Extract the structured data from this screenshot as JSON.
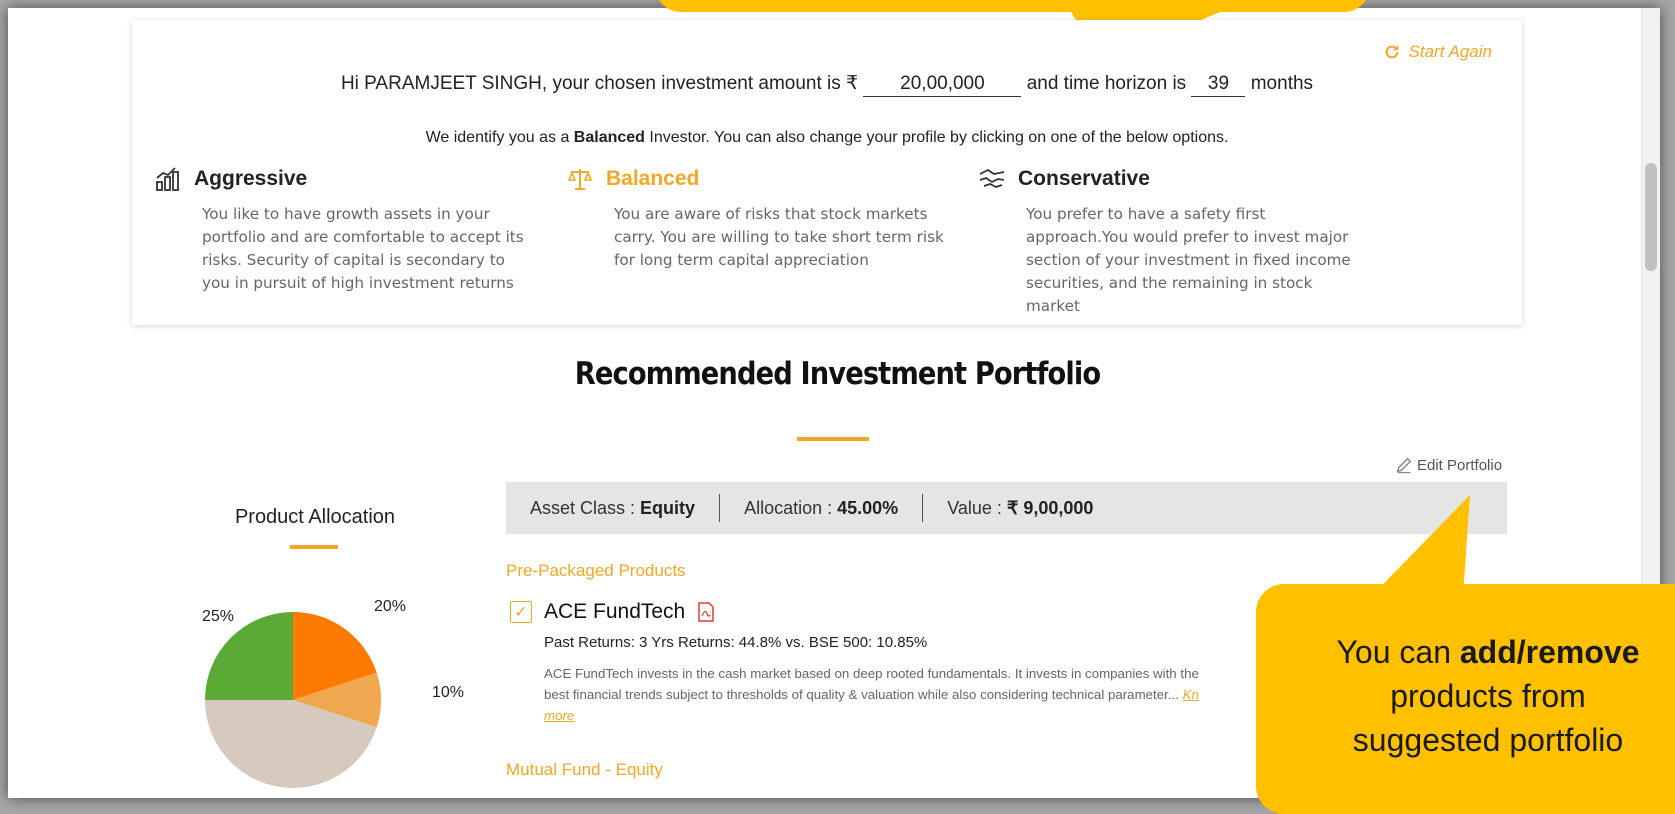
{
  "header": {
    "start_again": "Start Again",
    "greeting_prefix": "Hi PARAMJEET SINGH, your chosen investment amount is",
    "currency": "₹",
    "amount": "20,00,000",
    "horizon_prefix": "and time horizon is",
    "months": "39",
    "months_suffix": "months",
    "identify_prefix": "We identify you as a",
    "identify_profile": "Balanced",
    "identify_suffix": "Investor. You can also change your profile by clicking on one of the below options."
  },
  "profiles": [
    {
      "title": "Aggressive",
      "icon": "chart-growth-icon",
      "desc": "You like to have growth assets in your portfolio and are comfortable to accept its risks. Security of capital is secondary to you in pursuit of high investment returns"
    },
    {
      "title": "Balanced",
      "icon": "scale-icon",
      "desc": "You are aware of risks that stock markets carry. You are willing to take short term risk for long term capital appreciation"
    },
    {
      "title": "Conservative",
      "icon": "handshake-icon",
      "desc": "You prefer to have a safety first approach.You would prefer to invest major section of your investment in fixed income securities, and the remaining in stock market"
    }
  ],
  "portfolio": {
    "title": "Recommended Investment Portfolio",
    "edit_label": "Edit Portfolio",
    "allocation_heading": "Product Allocation",
    "pie_labels": [
      "25%",
      "20%",
      "10%"
    ],
    "pie_slices": [
      {
        "value": 20,
        "color": "#ff7a00"
      },
      {
        "value": 10,
        "color": "#f0a850"
      },
      {
        "value": 45,
        "color": "#d6c9bd"
      },
      {
        "value": 25,
        "color": "#5aaa35"
      }
    ],
    "asset_class_label": "Asset Class :",
    "asset_class": "Equity",
    "allocation_label": "Allocation :",
    "allocation": "45.00%",
    "value_label": "Value :",
    "value": "₹ 9,00,000",
    "prepackaged_heading": "Pre-Packaged Products",
    "product_name": "ACE FundTech",
    "past_returns": "Past Returns: 3 Yrs Returns: 44.8% vs. BSE 500: 10.85%",
    "product_desc_1": "ACE FundTech invests in the cash market based on deep rooted fundamentals. It invests in companies with the",
    "product_desc_2": "best financial trends subject to thresholds of quality & valuation while also considering technical parameter...",
    "know_more_1": "Kn",
    "know_more_2": "more",
    "mf_heading": "Mutual Fund - Equity"
  },
  "callouts": {
    "right_pre": "You can",
    "right_bold": "add/remove",
    "right_line2": "products from",
    "right_line3": "suggested portfolio"
  }
}
